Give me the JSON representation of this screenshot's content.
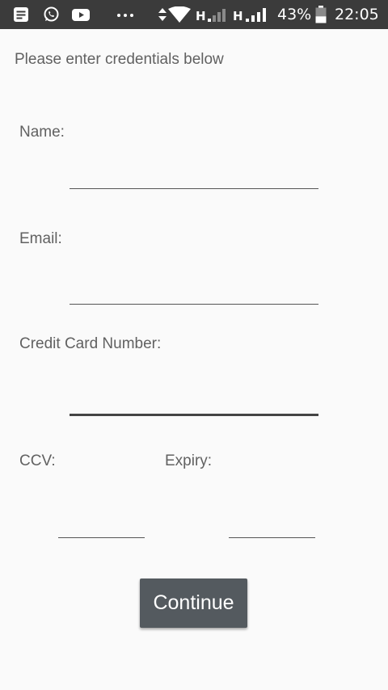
{
  "status_bar": {
    "time": "22:05",
    "battery_percent": "43%",
    "battery_level": 0.43,
    "network_1": "H",
    "network_2": "H",
    "notification_icons": [
      "message-icon",
      "whatsapp-icon",
      "youtube-icon",
      "more-dots-icon"
    ],
    "status_icons": [
      "data-arrows-icon",
      "wifi-icon",
      "signal-weak-icon",
      "signal-strong-icon",
      "battery-icon"
    ]
  },
  "form": {
    "instructions": "Please enter credentials below",
    "name_label": "Name:",
    "name_value": "",
    "email_label": "Email:",
    "email_value": "",
    "card_label": "Credit Card Number:",
    "card_value": "",
    "ccv_label": "CCV:",
    "ccv_value": "",
    "expiry_label": "Expiry:",
    "expiry_value": ""
  },
  "actions": {
    "continue_label": "Continue"
  },
  "colors": {
    "status_bar_bg": "#3b3b3b",
    "background": "#fafafa",
    "label_text": "#616161",
    "button_bg": "#545a5f",
    "button_text": "#ffffff"
  }
}
